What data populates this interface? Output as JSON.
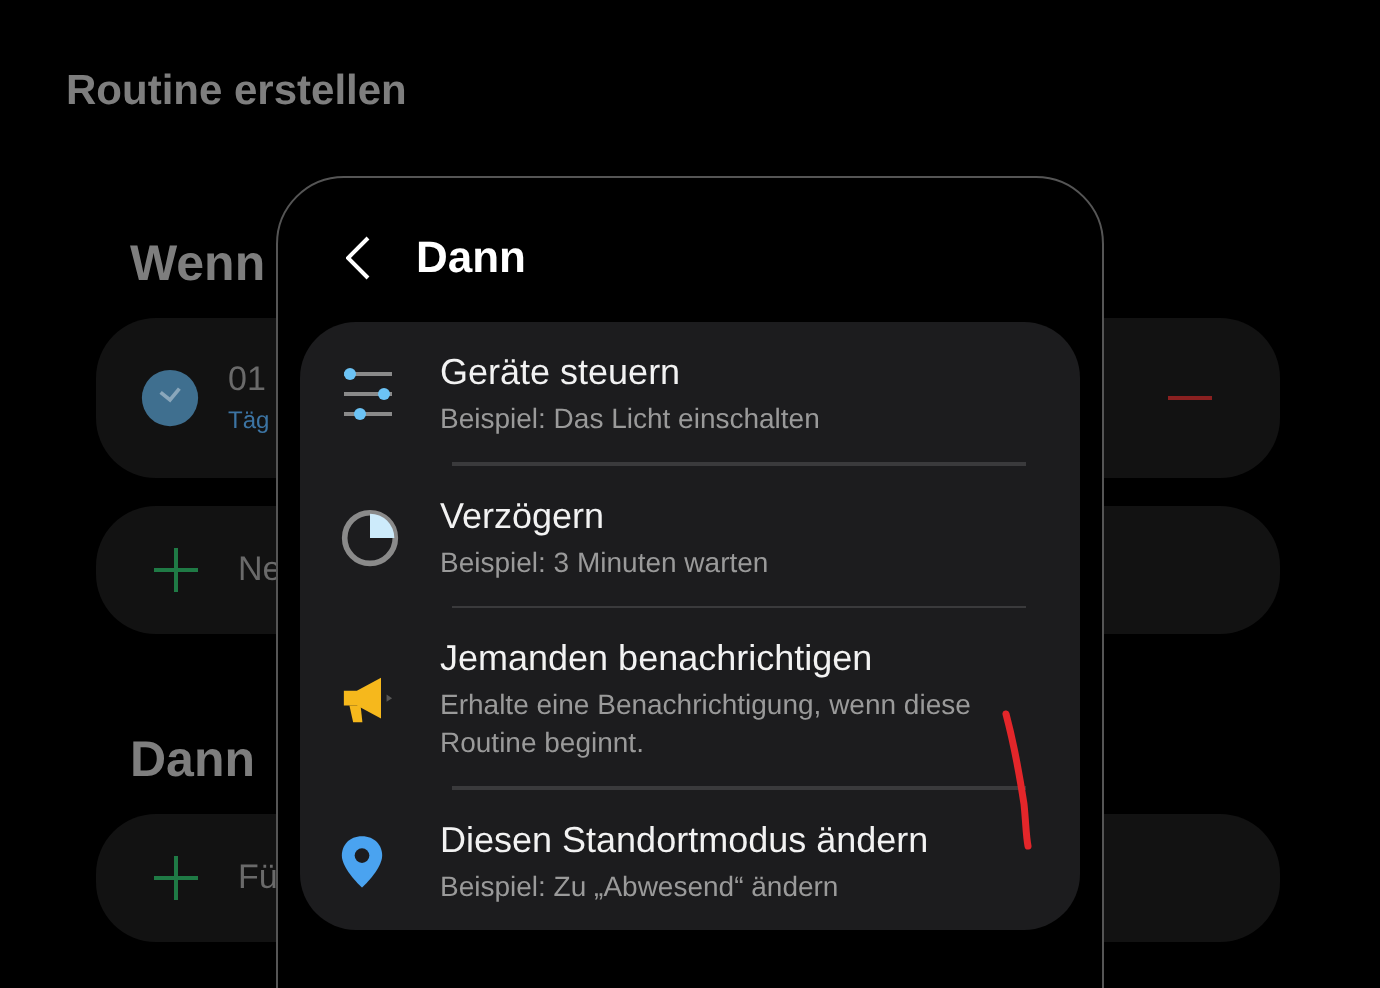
{
  "background": {
    "title": "Routine erstellen",
    "sections": [
      {
        "heading": "Wenn",
        "cards": [
          {
            "kind": "condition",
            "title": "01",
            "subtitle": "Täg"
          },
          {
            "kind": "add",
            "label": "Ne"
          }
        ]
      },
      {
        "heading": "Dann",
        "cards": [
          {
            "kind": "add",
            "label": "Fü"
          }
        ]
      }
    ]
  },
  "sheet": {
    "title": "Dann",
    "items": [
      {
        "kind": "sliders",
        "title": "Geräte steuern",
        "subtitle": "Beispiel: Das Licht einschalten"
      },
      {
        "kind": "timer",
        "title": "Verzögern",
        "subtitle": "Beispiel: 3 Minuten warten"
      },
      {
        "kind": "megaphone",
        "title": "Jemanden benachrichtigen",
        "subtitle": "Erhalte eine Benachrichtigung, wenn diese Routine beginnt."
      },
      {
        "kind": "pin",
        "title": "Diesen Standortmodus ändern",
        "subtitle": "Beispiel: Zu „Abwesend“ ändern"
      }
    ]
  }
}
